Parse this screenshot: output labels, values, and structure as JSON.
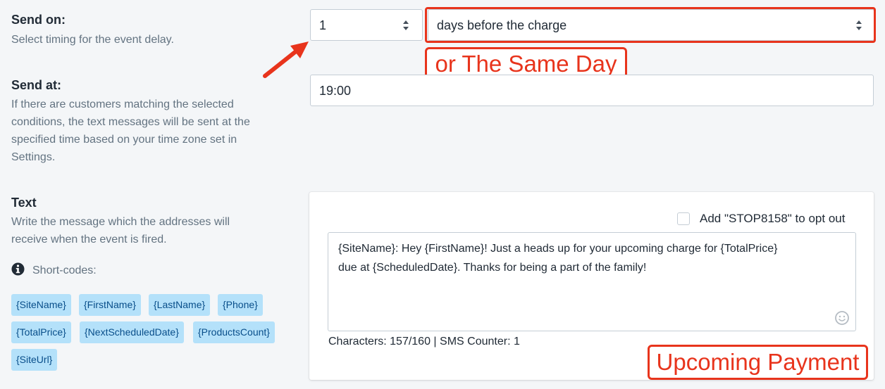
{
  "send_on": {
    "title": "Send on:",
    "description": "Select timing for the event delay.",
    "quantity_value": "1",
    "timing_value": "days before the charge"
  },
  "send_at": {
    "title": "Send at:",
    "description_lines": [
      "If there are customers matching the selected",
      "conditions, the text messages will be sent at the",
      "specified time based on your time zone set in",
      "Settings."
    ],
    "time_value": "19:00"
  },
  "text_section": {
    "title": "Text",
    "description_lines": [
      "Write the message which the addresses will",
      "receive when the event is fired."
    ],
    "shortcodes_label": "Short-codes:",
    "shortcodes": [
      "{SiteName}",
      "{FirstName}",
      "{LastName}",
      "{Phone}",
      "{TotalPrice}",
      "{NextScheduledDate}",
      "{ProductsCount}",
      "{SiteUrl}"
    ],
    "optout_label": "Add \"STOP8158\" to opt out",
    "optout_checked": false,
    "message_lines": [
      "{SiteName}: Hey {FirstName}! Just a heads up for your upcoming charge for {TotalPrice}",
      "due at {ScheduledDate}. Thanks for being a part of the family!"
    ],
    "counter": "Characters: 157/160 | SMS Counter: 1"
  },
  "annotations": {
    "same_day": "or The Same Day",
    "upcoming_payment": "Upcoming Payment"
  },
  "colors": {
    "annotation_red": "#e8341c",
    "chip_bg": "#b4e1fa",
    "chip_text": "#084e8a"
  }
}
